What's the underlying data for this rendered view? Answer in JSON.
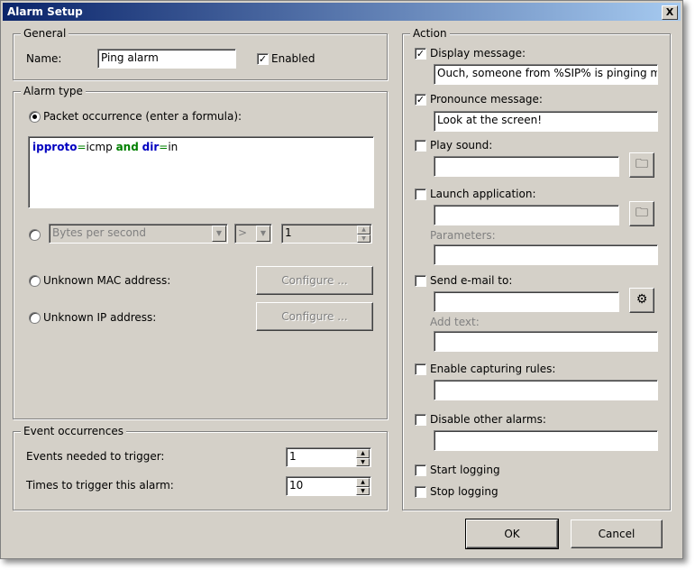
{
  "window": {
    "title": "Alarm Setup",
    "close_label": "X"
  },
  "general": {
    "legend": "General",
    "name_label": "Name:",
    "name_value": "Ping alarm",
    "enabled_label": "Enabled",
    "enabled_checked": true
  },
  "alarm_type": {
    "legend": "Alarm type",
    "packet_label": "Packet occurrence (enter a formula):",
    "formula": {
      "t1": "ipproto",
      "t2": "=",
      "t3": "icmp ",
      "t4": "and",
      "t5": " ",
      "t6": "dir",
      "t7": "=",
      "t8": "in"
    },
    "bytes_select": "Bytes per second",
    "operator_select": ">",
    "threshold_value": "1",
    "unknown_mac_label": "Unknown MAC address:",
    "unknown_ip_label": "Unknown IP address:",
    "configure_label": "Configure ..."
  },
  "events": {
    "legend": "Event occurrences",
    "needed_label": "Events needed to trigger:",
    "needed_value": "1",
    "times_label": "Times to trigger this alarm:",
    "times_value": "10"
  },
  "action": {
    "legend": "Action",
    "display_label": "Display message:",
    "display_value": "Ouch, someone from %SIP% is pinging me",
    "pronounce_label": "Pronounce message:",
    "pronounce_value": "Look at the screen!",
    "play_sound_label": "Play sound:",
    "launch_label": "Launch application:",
    "parameters_label": "Parameters:",
    "send_email_label": "Send e-mail to:",
    "add_text_label": "Add text:",
    "capture_label": "Enable capturing rules:",
    "disable_alarms_label": "Disable other alarms:",
    "start_logging_label": "Start logging",
    "stop_logging_label": "Stop logging"
  },
  "buttons": {
    "ok": "OK",
    "cancel": "Cancel"
  },
  "glyphs": {
    "check": "✓",
    "up": "▲",
    "down": "▼",
    "folder": "🗀",
    "gear": "⚙"
  }
}
